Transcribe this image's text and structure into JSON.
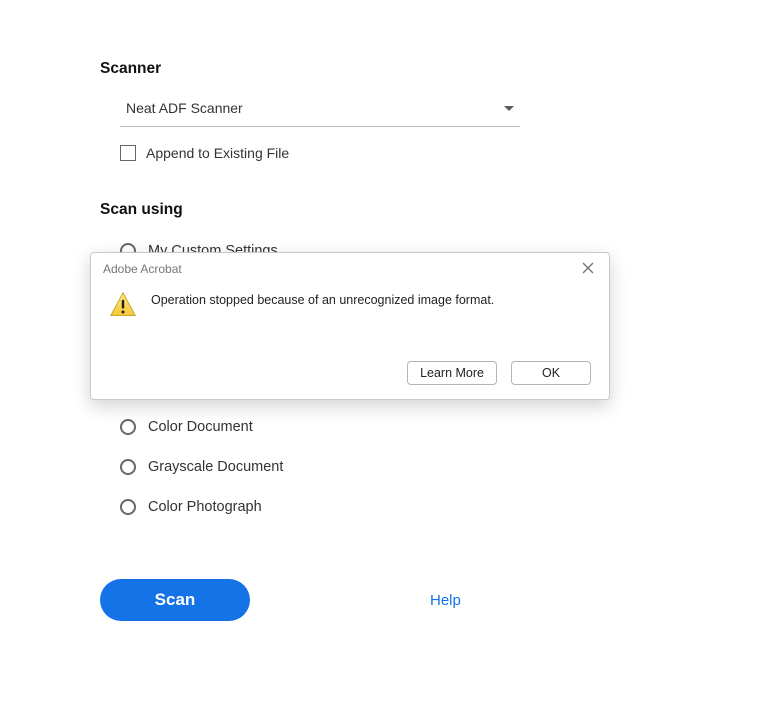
{
  "sections": {
    "scanner_label": "Scanner",
    "scan_using_label": "Scan using"
  },
  "scanner": {
    "selected": "Neat ADF Scanner",
    "append_label": "Append to Existing File",
    "append_checked": false
  },
  "scan_using": {
    "options": [
      {
        "label": "My Custom Settings"
      },
      {
        "label": "Color Document"
      },
      {
        "label": "Grayscale Document"
      },
      {
        "label": "Color Photograph"
      }
    ]
  },
  "actions": {
    "scan_label": "Scan",
    "help_label": "Help"
  },
  "dialog": {
    "title": "Adobe Acrobat",
    "message": "Operation stopped because of an unrecognized image format.",
    "learn_more_label": "Learn More",
    "ok_label": "OK"
  }
}
